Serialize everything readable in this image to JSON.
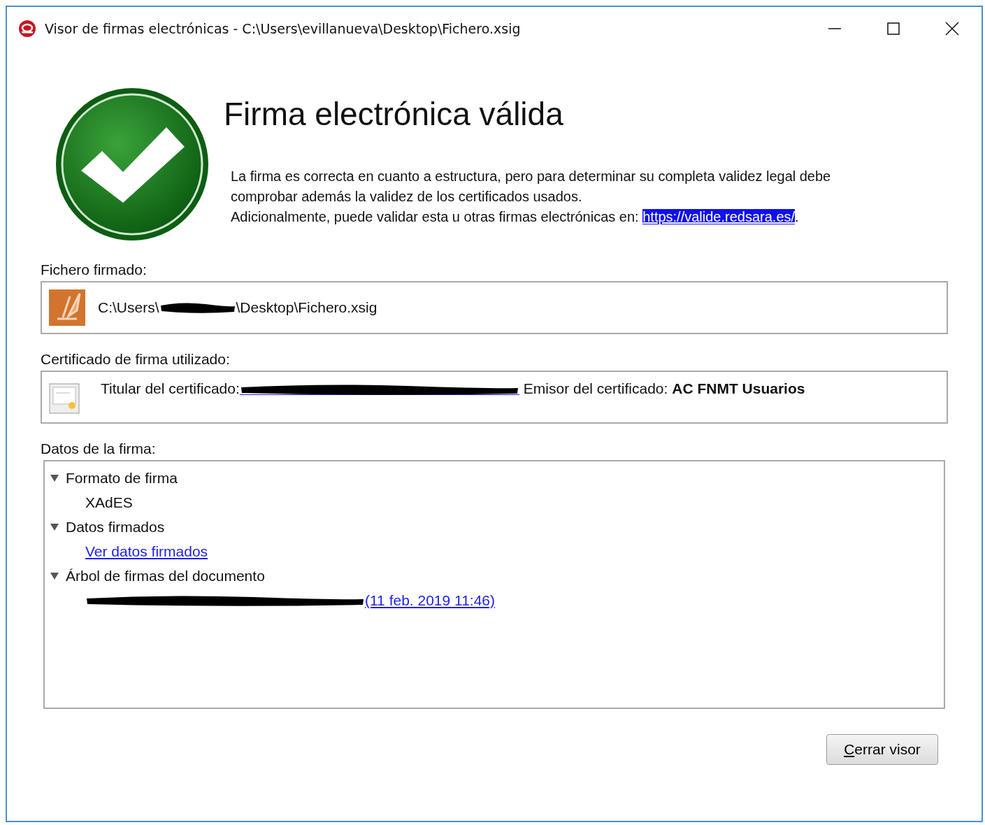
{
  "window": {
    "title": "Visor de firmas electrónicas - C:\\Users\\evillanueva\\Desktop\\Fichero.xsig"
  },
  "heading": "Firma electrónica válida",
  "description": {
    "text": "La firma es correcta en cuanto a estructura, pero para determinar su completa validez legal debe comprobar además la validez de los certificados usados.",
    "extra": "Adicionalmente, puede validar esta u otras firmas electrónicas en: ",
    "link": {
      "text": "https://valide.redsara.es/",
      "selected": true
    },
    "after": "."
  },
  "file": {
    "label": "Fichero firmado:",
    "path_start": "C:\\Users\\",
    "path_end": "\\Desktop\\Fichero.xsig",
    "redacted": true
  },
  "certificate": {
    "label": "Certificado de firma utilizado:",
    "holder_label": "Titular del certificado:",
    "holder_redacted": true,
    "issuer": "Emisor del certificado: **AC FNMT Usuarios**"
  },
  "signature": {
    "label": "Datos de la firma:",
    "tree": [
      {
        "text": "Formato de firma",
        "expanded": true,
        "children": [
          {
            "kind": "text",
            "text": "XAdES"
          }
        ]
      },
      {
        "text": "Datos firmados",
        "expanded": true,
        "children": [
          {
            "kind": "link",
            "text": "Ver datos firmados"
          }
        ]
      },
      {
        "text": "Árbol de firmas del documento",
        "expanded": true,
        "children": [
          {
            "kind": "link",
            "text": "(11 feb. 2019 11:46)",
            "redacted": true
          }
        ]
      }
    ]
  },
  "close_button": {
    "label": "Cerrar visor"
  }
}
